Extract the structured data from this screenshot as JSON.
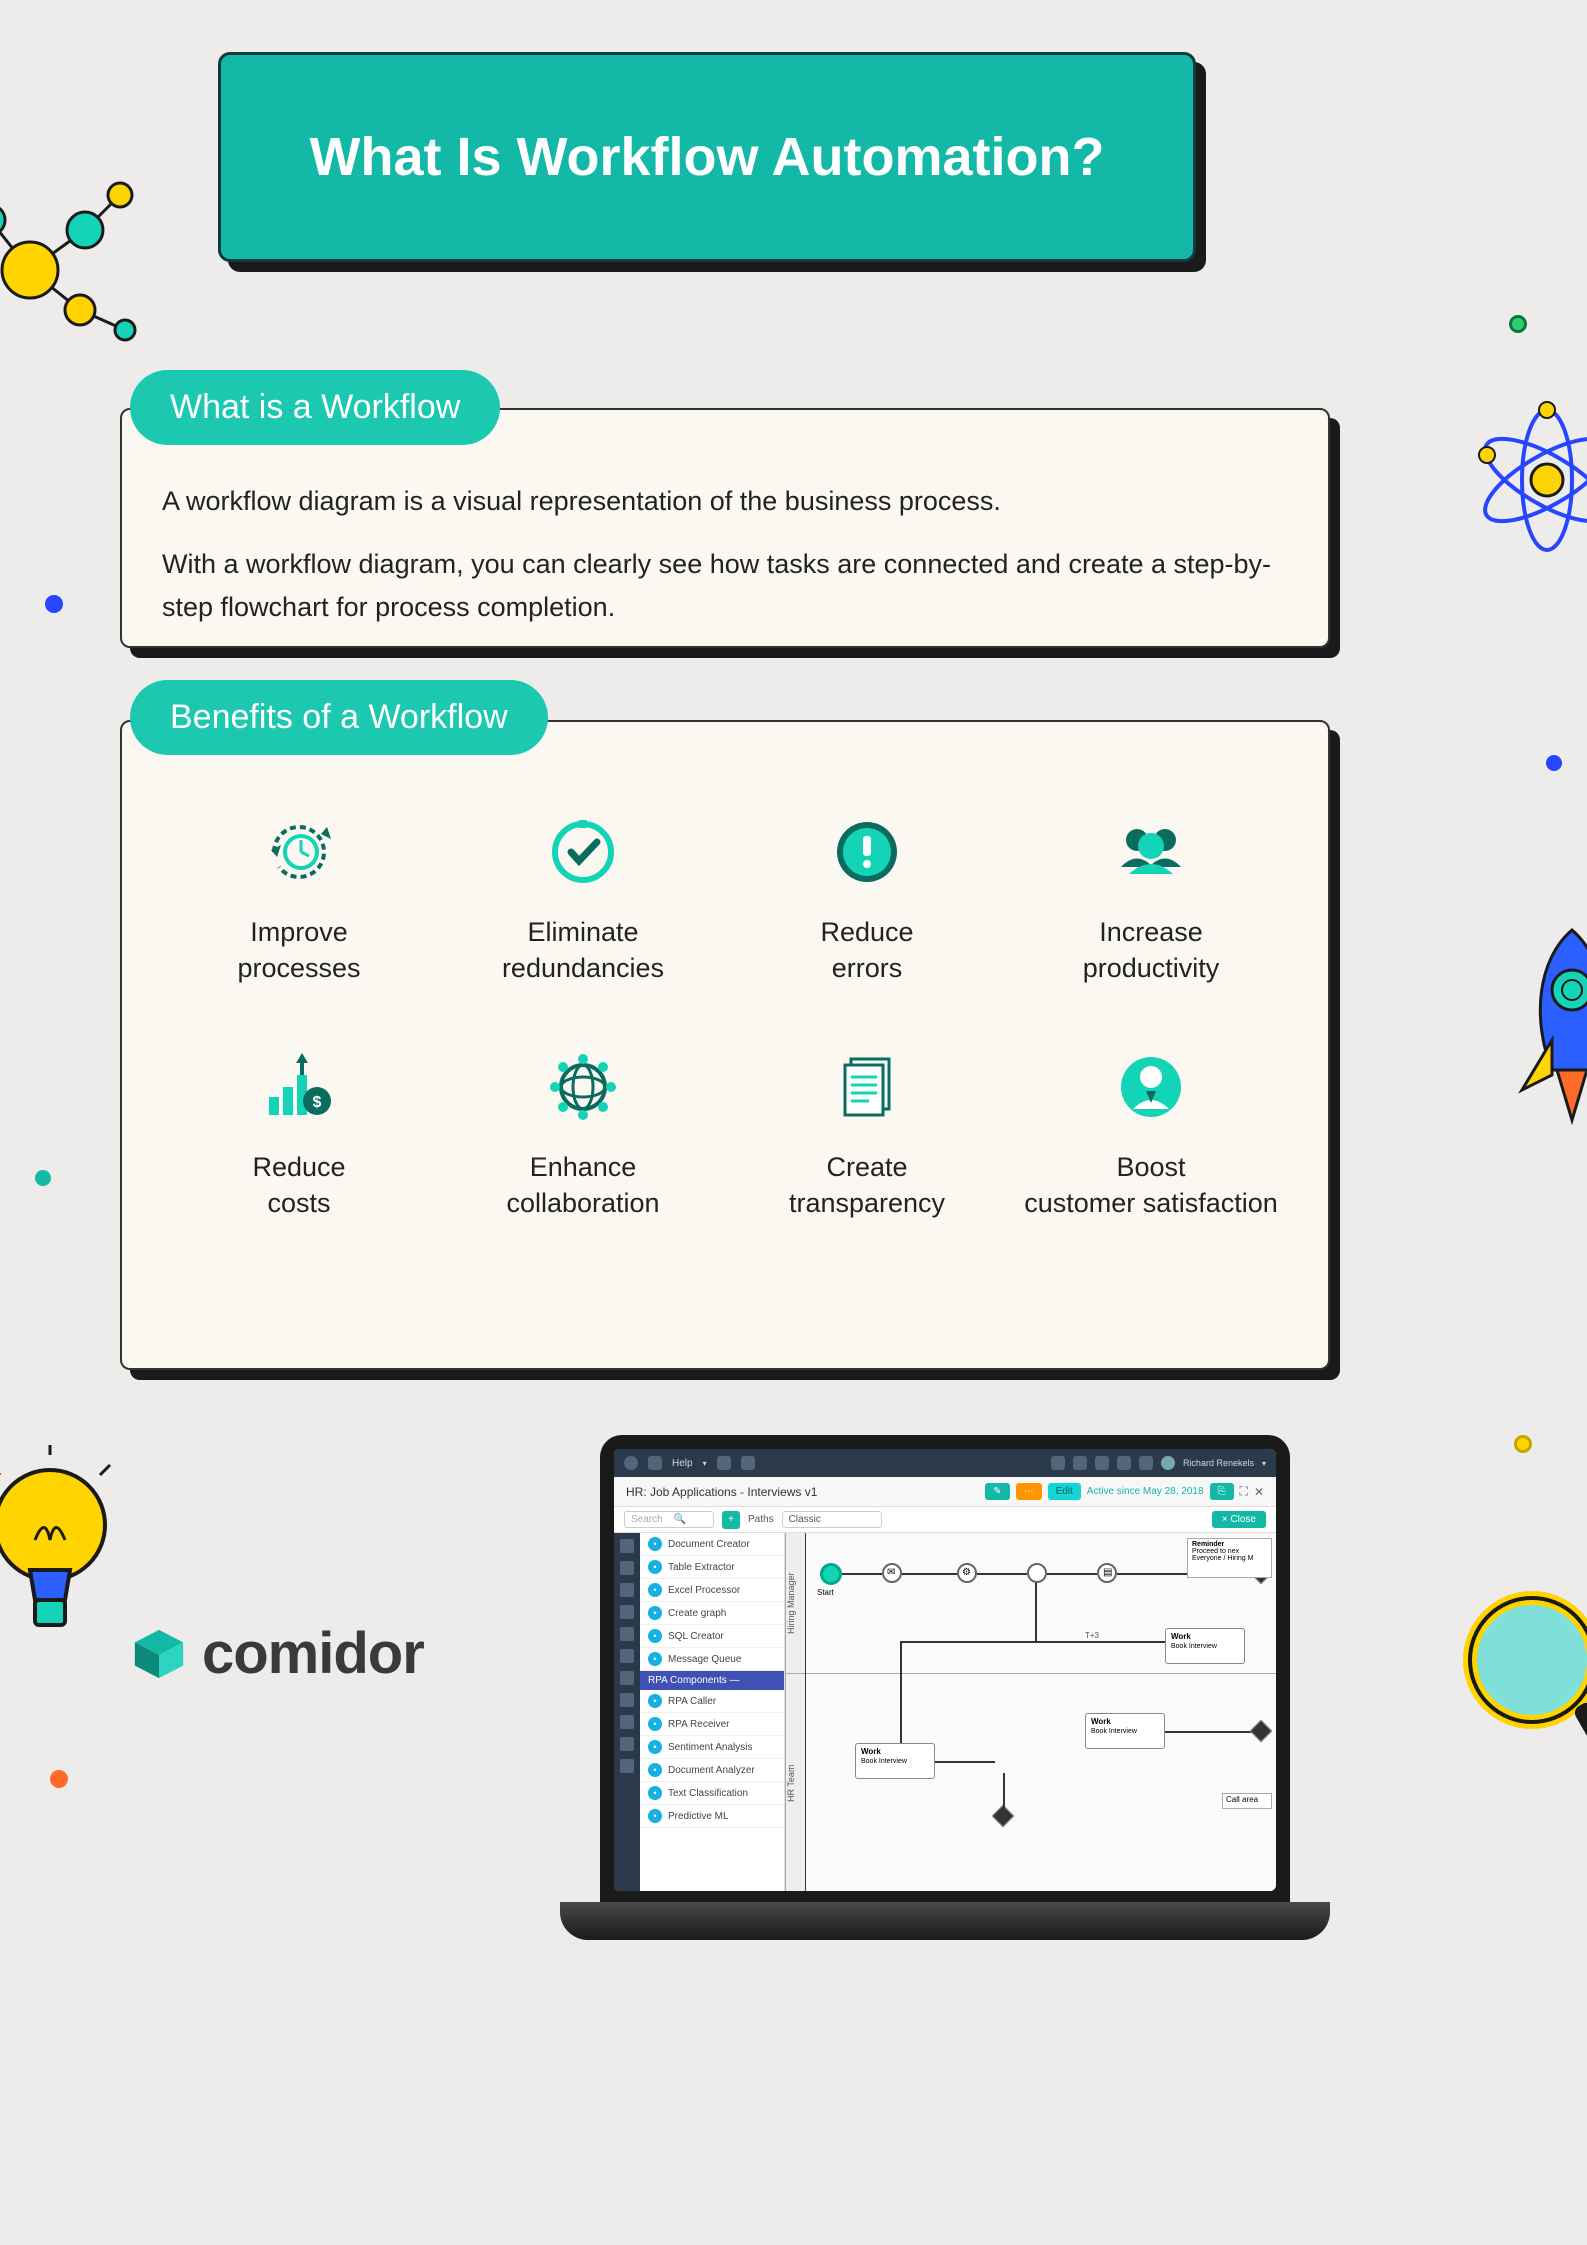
{
  "title": "What Is Workflow Automation?",
  "section1": {
    "pill": "What is a Workflow",
    "p1": "A workflow diagram is a visual representation of the business process.",
    "p2": "With a workflow diagram, you can clearly see how tasks are connected and create a step-by-step flowchart for process completion."
  },
  "section2": {
    "pill": "Benefits of a Workflow",
    "items": [
      {
        "label": "Improve processes",
        "icon": "clock-cycle-icon"
      },
      {
        "label": "Eliminate redundancies",
        "icon": "checkmark-circle-icon"
      },
      {
        "label": "Reduce errors",
        "icon": "alert-circle-icon"
      },
      {
        "label": "Increase productivity",
        "icon": "users-icon"
      },
      {
        "label": "Reduce costs",
        "icon": "chart-money-icon"
      },
      {
        "label": "Enhance collaboration",
        "icon": "globe-network-icon"
      },
      {
        "label": "Create transparency",
        "icon": "document-icon"
      },
      {
        "label": "Boost customer satisfaction",
        "icon": "person-badge-icon"
      }
    ]
  },
  "logo": "comidor",
  "laptop": {
    "topbar": {
      "help": "Help",
      "user": "Richard Renekels"
    },
    "titlebar": {
      "title": "HR: Job Applications - Interviews v1",
      "status": "Active since May 28, 2018",
      "edit": "Edit"
    },
    "toolbar": {
      "search_placeholder": "Search",
      "paths": "Paths",
      "classic": "Classic",
      "close": "× Close"
    },
    "panel": {
      "groupA": [
        "Document Creator",
        "Table Extractor",
        "Excel Processor",
        "Create graph",
        "SQL Creator",
        "Message Queue"
      ],
      "header": "RPA Components",
      "groupB": [
        "RPA Caller",
        "RPA Receiver",
        "Sentiment Analysis",
        "Document Analyzer",
        "Text Classification",
        "Predictive ML"
      ]
    },
    "canvas": {
      "lane1": "Hiring Manager",
      "lane2": "HR Team",
      "start": "Start",
      "note": "Reminder",
      "note2": "Proceed to nex",
      "note3": "Everyone / Hiring M",
      "task1": "Work",
      "task1b": "Book Interview",
      "task2": "Work",
      "task2b": "Book Interview",
      "task3": "Work",
      "task3b": "Book Interview",
      "callarea": "Call area"
    }
  }
}
